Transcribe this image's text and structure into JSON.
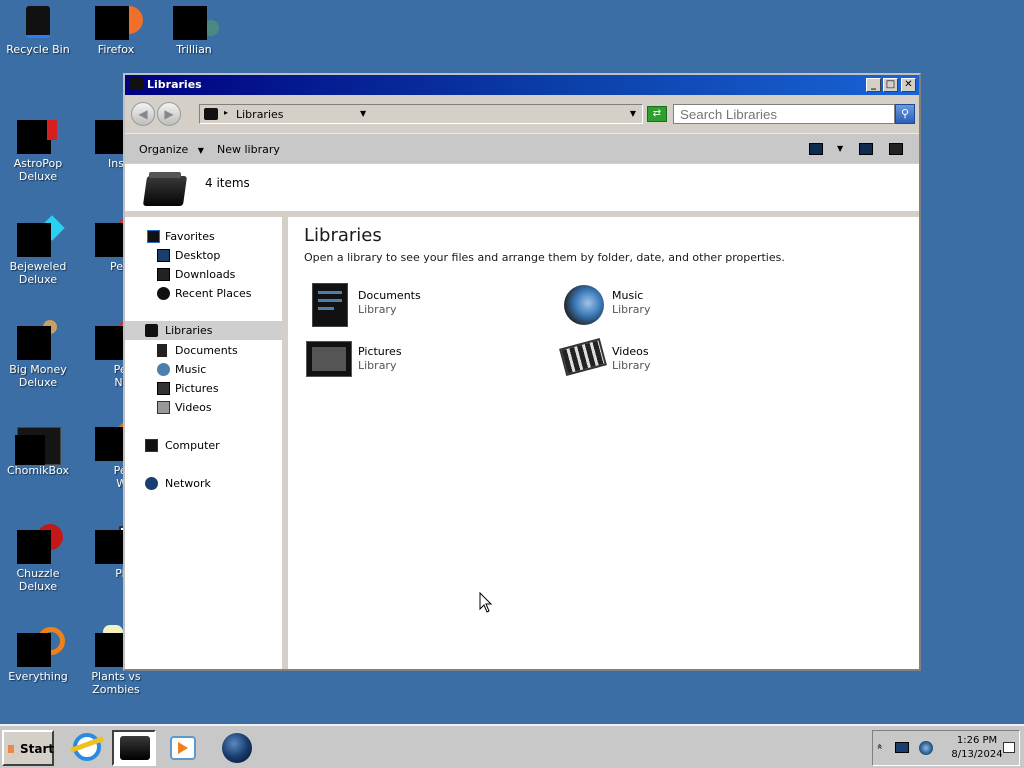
{
  "desktop": {
    "icons": [
      {
        "label": "Recycle Bin"
      },
      {
        "label": "Firefox"
      },
      {
        "label": "Trillian"
      },
      {
        "label": "AstroPop Deluxe"
      },
      {
        "label": "Insaniquarium Deluxe"
      },
      {
        "label": "Bejeweled Deluxe"
      },
      {
        "label": "Peggle Deluxe"
      },
      {
        "label": "Big Money Deluxe"
      },
      {
        "label": "Peggle Nights Deluxe"
      },
      {
        "label": "ChomikBox"
      },
      {
        "label": "Peggle World of Warcraft"
      },
      {
        "label": "Chuzzle Deluxe"
      },
      {
        "label": "Pidgin"
      },
      {
        "label": "Everything"
      },
      {
        "label": "Plants vs Zombies"
      }
    ]
  },
  "window": {
    "title": "Libraries",
    "address": "Libraries",
    "search_placeholder": "Search Libraries",
    "commands": {
      "organize": "Organize",
      "new_library": "New library"
    },
    "info": {
      "count": "4 items"
    },
    "nav": {
      "favorites": "Favorites",
      "desktop": "Desktop",
      "downloads": "Downloads",
      "recent_places": "Recent Places",
      "libraries": "Libraries",
      "documents": "Documents",
      "music": "Music",
      "pictures": "Pictures",
      "videos": "Videos",
      "computer": "Computer",
      "network": "Network"
    },
    "content": {
      "heading": "Libraries",
      "subtitle": "Open a library to see your files and arrange them by folder, date, and other properties.",
      "libraries": [
        {
          "name": "Documents",
          "type": "Library"
        },
        {
          "name": "Music",
          "type": "Library"
        },
        {
          "name": "Pictures",
          "type": "Library"
        },
        {
          "name": "Videos",
          "type": "Library"
        }
      ]
    }
  },
  "taskbar": {
    "start_label": "Start",
    "clock_time": "1:26 PM",
    "clock_date": "8/13/2024",
    "tray_expand": "»"
  },
  "colors": {
    "desktop_bg": "#3a6ea5",
    "titlebar_start": "#000080",
    "titlebar_end": "#1a63d6",
    "chrome": "#d4d0c8"
  }
}
